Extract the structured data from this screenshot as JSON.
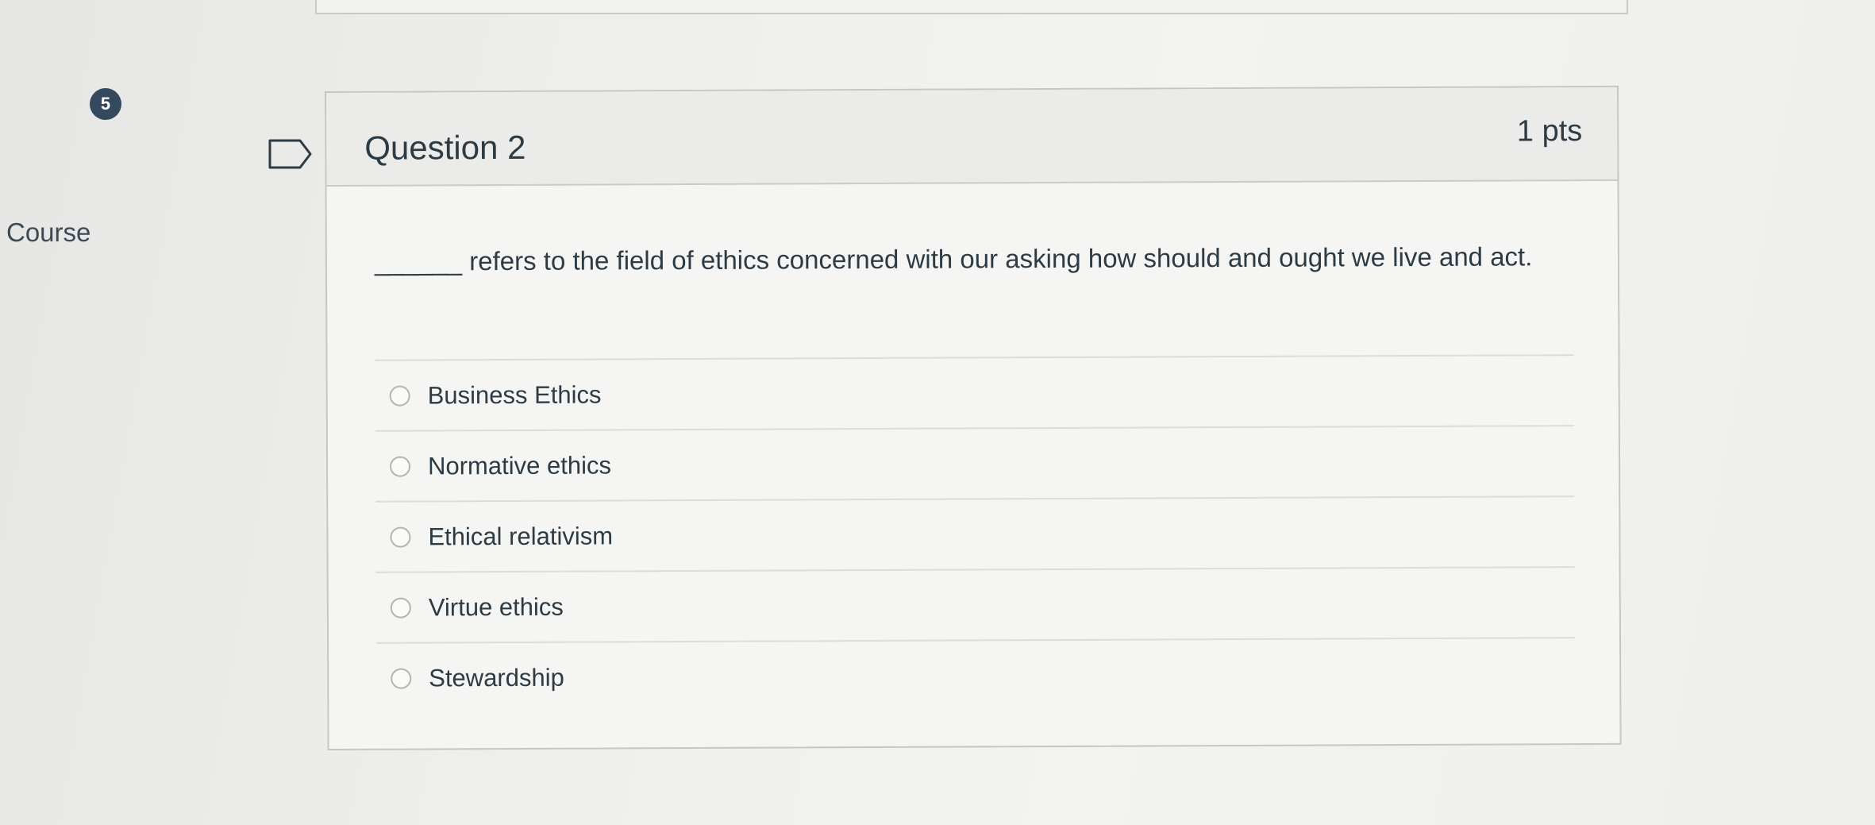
{
  "sidebar": {
    "badge_count": "5",
    "course_label": "Course"
  },
  "question": {
    "title": "Question 2",
    "points": "1 pts",
    "text": "______ refers to the field of ethics concerned with our asking how should and ought we live and act.",
    "answers": [
      {
        "label": "Business Ethics"
      },
      {
        "label": "Normative ethics"
      },
      {
        "label": "Ethical relativism"
      },
      {
        "label": "Virtue ethics"
      },
      {
        "label": "Stewardship"
      }
    ]
  },
  "icons": {
    "flag": "flag-icon",
    "radio": "radio-button"
  },
  "colors": {
    "badge_bg": "#34495e",
    "text": "#2d3b45",
    "border": "#c6c6c4"
  }
}
